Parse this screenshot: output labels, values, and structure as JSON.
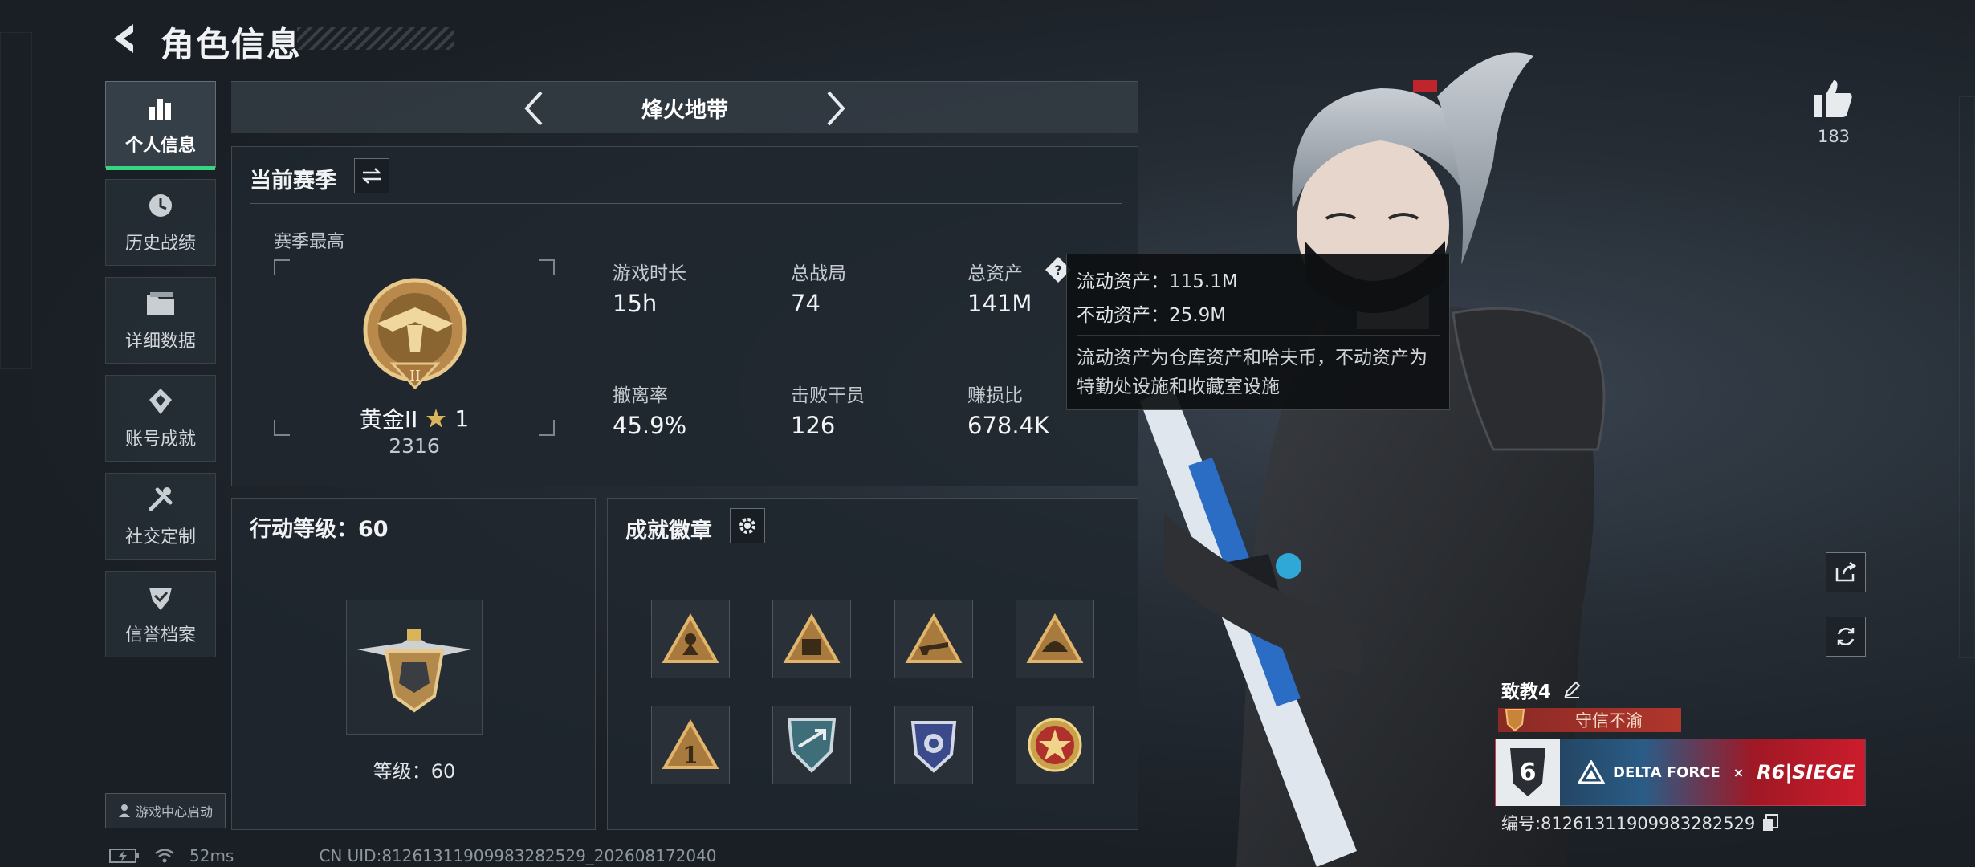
{
  "header": {
    "title": "角色信息"
  },
  "sidebar": {
    "items": [
      {
        "label": "个人信息",
        "icon": "bar-chart-icon",
        "active": true
      },
      {
        "label": "历史战绩",
        "icon": "history-clock-icon"
      },
      {
        "label": "详细数据",
        "icon": "folder-icon"
      },
      {
        "label": "账号成就",
        "icon": "achievement-gem-icon"
      },
      {
        "label": "社交定制",
        "icon": "wrench-icon"
      },
      {
        "label": "信誉档案",
        "icon": "shield-check-icon"
      }
    ],
    "launch_label": "游戏中心启动"
  },
  "mode": {
    "title": "烽火地带"
  },
  "season": {
    "title": "当前赛季",
    "best_label": "赛季最高",
    "rank_name": "黄金II",
    "rank_stars": "1",
    "rank_score": "2316",
    "stats": [
      {
        "label": "游戏时长",
        "value": "15h"
      },
      {
        "label": "总战局",
        "value": "74"
      },
      {
        "label": "总资产",
        "value": "141M"
      },
      {
        "label": "撤离率",
        "value": "45.9%"
      },
      {
        "label": "击败干员",
        "value": "126"
      },
      {
        "label": "赚损比",
        "value": "678.4K"
      }
    ]
  },
  "tooltip": {
    "liquid": "流动资产：115.1M",
    "fixed": "不动资产：25.9M",
    "desc": "流动资产为仓库资产和哈夫币，不动资产为特勤处设施和收藏室设施"
  },
  "level": {
    "title": "行动等级：60",
    "label": "等级：60"
  },
  "badges": {
    "title": "成就徽章",
    "items": [
      "badge-triangle-figure",
      "badge-triangle-crate",
      "badge-triangle-gun",
      "badge-triangle-helmet",
      "badge-triangle-number-one",
      "badge-shield-arrows",
      "badge-police-shield",
      "badge-star-emblem"
    ]
  },
  "player": {
    "likes": "183",
    "name": "致教4",
    "reputation": "守信不渝",
    "banner_rank": "6",
    "banner_brand": "DELTA FORCE",
    "banner_x": "×",
    "banner_collab": "R6|SIEGE",
    "uid": "编号:8126131190998328252​9"
  },
  "status": {
    "ping": "52ms",
    "cn_uid": "CN UID:8126131190998328252​9_202608172040"
  },
  "colors": {
    "accent_green": "#37d680",
    "rep_red": "#b0362c",
    "panel": "#20272e"
  }
}
